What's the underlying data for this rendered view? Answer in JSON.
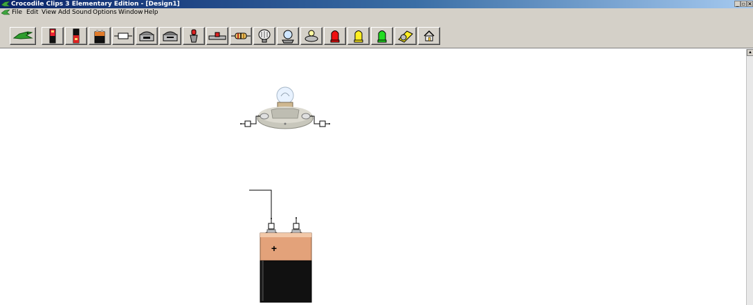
{
  "window": {
    "title": "Crocodile Clips 3 Elementary Edition - [Design1]",
    "controls": [
      "_",
      "▫",
      "×"
    ],
    "menu_controls": [
      "_",
      "▫",
      "×"
    ]
  },
  "menu": {
    "items": [
      "File",
      "Edit",
      "View",
      "Add",
      "Sound",
      "Options",
      "Window",
      "Help"
    ]
  },
  "toolbar": {
    "buttons": [
      {
        "icon": "crocodile-clip-icon"
      },
      {
        "icon": "cell-battery-icon"
      },
      {
        "icon": "battery-pack-icon"
      },
      {
        "icon": "9v-battery-icon"
      },
      {
        "icon": "fuse-icon"
      },
      {
        "icon": "switch-icon"
      },
      {
        "icon": "switch-2way-icon"
      },
      {
        "icon": "push-switch-icon"
      },
      {
        "icon": "variable-resistor-icon"
      },
      {
        "icon": "resistor-icon"
      },
      {
        "icon": "capacitor-icon"
      },
      {
        "icon": "bulb-icon"
      },
      {
        "icon": "lamp-holder-icon"
      },
      {
        "icon": "led-red-icon"
      },
      {
        "icon": "led-yellow-icon"
      },
      {
        "icon": "led-green-icon"
      },
      {
        "icon": "motor-icon"
      },
      {
        "icon": "home-icon"
      }
    ]
  },
  "canvas": {
    "components": [
      {
        "name": "lamp-bulb",
        "type": "bulb"
      },
      {
        "name": "battery-9v",
        "type": "battery",
        "positive_label": "+"
      }
    ]
  },
  "colors": {
    "titlebar_start": "#0a246a",
    "titlebar_end": "#a6caf0",
    "chrome": "#d4d0c8",
    "battery_copper": "#e0a078",
    "battery_black": "#111111"
  }
}
